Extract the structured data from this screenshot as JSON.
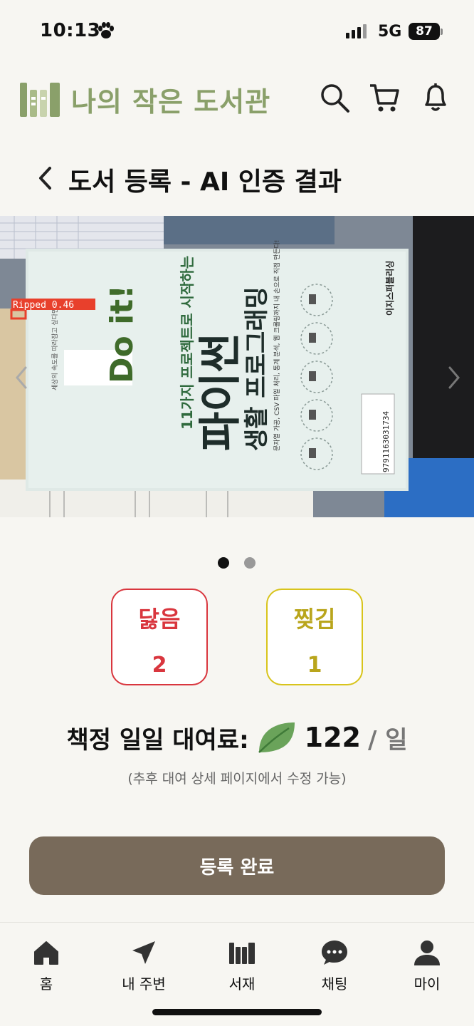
{
  "status_bar": {
    "time": "10:13",
    "network": "5G",
    "battery": "87"
  },
  "header": {
    "app_title": "나의 작은 도서관"
  },
  "page": {
    "title": "도서 등록 - AI 인증 결과"
  },
  "photo": {
    "detection_label": "Ripped 0.46",
    "book_series_top": "세상의 속도를 따라잡고 싶다면",
    "book_series": "Do it!",
    "book_subtitle": "11가지 프로젝트로 시작하는",
    "book_title_line1": "파이썬",
    "book_title_line2": "생활 프로그래밍",
    "book_caption": "문자열 가공, CSV 파일 처리, 통계 분석, 웹 크롤링까지 내 손으로 직접 만든다!",
    "publisher": "이지스퍼블리싱",
    "isbn": "9791163031734"
  },
  "carousel": {
    "active_index": 0,
    "count": 2
  },
  "condition": {
    "worn": {
      "label": "닳음",
      "value": "2",
      "color": "#d9363e"
    },
    "torn": {
      "label": "찢김",
      "value": "1",
      "color": "#b9a51c"
    }
  },
  "fee": {
    "label": "책정 일일 대여료:",
    "value": "122",
    "unit": "/ 일",
    "note": "(추후 대여 상세 페이지에서 수정 가능)"
  },
  "submit_label": "등록 완료",
  "nav": [
    {
      "label": "홈",
      "icon": "home-icon"
    },
    {
      "label": "내 주변",
      "icon": "location-arrow-icon"
    },
    {
      "label": "서재",
      "icon": "bookshelf-icon"
    },
    {
      "label": "채팅",
      "icon": "chat-icon"
    },
    {
      "label": "마이",
      "icon": "person-icon"
    }
  ],
  "colors": {
    "brand": "#8aa06a",
    "button": "#786a5a",
    "background": "#f7f6f2"
  }
}
